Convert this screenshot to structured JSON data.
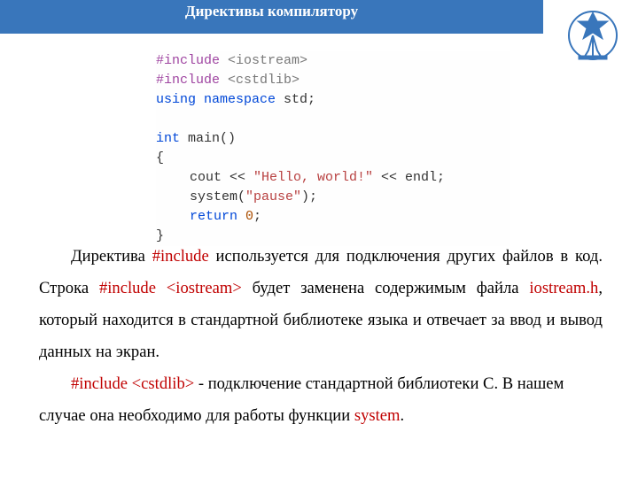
{
  "header": {
    "title": "Директивы компилятору"
  },
  "code": {
    "include_kw": "#include",
    "iostream": "<iostream>",
    "cstdlib": "<cstdlib>",
    "using_kw": "using",
    "namespace_kw": "namespace",
    "std_tok": " std;",
    "int_kw": "int",
    "main_tok": " main()",
    "brace_open": "{",
    "cout_tok": "cout << ",
    "hello_str": "\"Hello, world!\"",
    "endl_tok": " << endl;",
    "system_tok": "system(",
    "pause_str": "\"pause\"",
    "system_close": ");",
    "return_kw": "return",
    "zero": "0",
    "semicolon": ";",
    "brace_close": "}"
  },
  "body": {
    "p1_a": "Директива ",
    "p1_b": "#include",
    "p1_c": " используется для подключения других файлов в код. Строка ",
    "p1_d": "#include <iostream>",
    "p1_e": " будет заменена содержимым файла ",
    "p1_f": "iostream.h",
    "p1_g": ", который находится в стандартной библиотеке языка и отвечает за ввод и вывод данных на экран.",
    "p2_a": "#include <cstdlib>",
    "p2_b": " - подключение стандартной библиотеки С. В нашем случае она необходимо для работы функции ",
    "p2_c": "system",
    "p2_d": "."
  },
  "logo": {
    "name": "university-emblem"
  }
}
